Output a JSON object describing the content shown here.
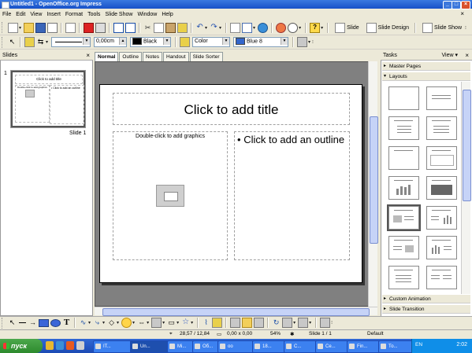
{
  "window": {
    "title": "Untitled1 - OpenOffice.org Impress"
  },
  "menu": [
    "File",
    "Edit",
    "View",
    "Insert",
    "Format",
    "Tools",
    "Slide Show",
    "Window",
    "Help"
  ],
  "toolbar1": {
    "slide_label": "Slide",
    "slide_design_label": "Slide Design",
    "slide_show_label": "Slide Show"
  },
  "toolbar2": {
    "line_width": "0,00cm",
    "line_color": "Black",
    "area_style": "Color",
    "area_color": "Blue 8",
    "colors": {
      "line": "#000000",
      "area": "#3366cc"
    }
  },
  "slides_panel": {
    "title": "Slides",
    "slide_number": "1",
    "slide_label": "Slide 1"
  },
  "view_tabs": [
    "Normal",
    "Outline",
    "Notes",
    "Handout",
    "Slide Sorter"
  ],
  "slide": {
    "title_placeholder": "Click to add title",
    "graphics_placeholder": "Double-click to add graphics",
    "outline_placeholder": "Click to add an outline"
  },
  "thumb": {
    "title": "Click to add title",
    "graphics": "Double-click to add graphics",
    "outline": "• Click to add an outline"
  },
  "tasks": {
    "title": "Tasks",
    "view_label": "View",
    "sections": {
      "master_pages": "Master Pages",
      "layouts": "Layouts",
      "custom_animation": "Custom Animation",
      "slide_transition": "Slide Transition"
    }
  },
  "status": {
    "position": "28,57 / 12,84",
    "size": "0,00 x 0,00",
    "zoom": "54%",
    "slide": "Slide 1 / 1",
    "master": "Default"
  },
  "taskbar": {
    "start": "пуск",
    "tasks": [
      "IT...",
      "Un...",
      "Mi...",
      "Об...",
      "оо",
      "18...",
      "C...",
      "Се...",
      "Fin...",
      "То..."
    ],
    "lang": "EN",
    "clock": "2:02"
  }
}
